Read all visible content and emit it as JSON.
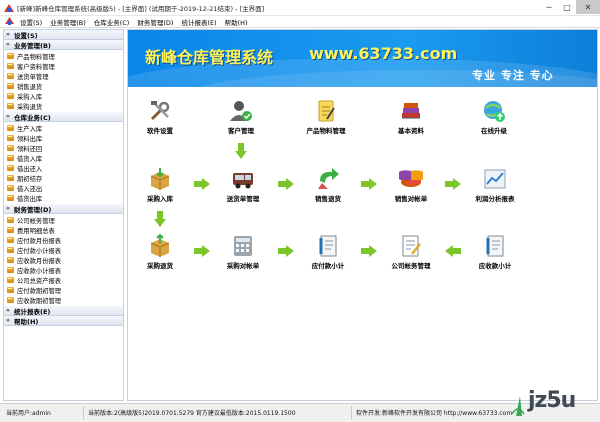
{
  "window": {
    "title": "[新峰]新峰仓库管理系统(高级版5) - [主界面] (试用期于-2019-12-21结束) - [主界面]",
    "min": "─",
    "max": "□",
    "close": "✕"
  },
  "menu": [
    "设置(S)",
    "业务管理(B)",
    "仓库业务(C)",
    "财务管理(D)",
    "统计报表(E)",
    "帮助(H)"
  ],
  "sidebar": {
    "sections": [
      {
        "title": "设置(S)",
        "items": []
      },
      {
        "title": "业务管理(B)",
        "items": [
          "产品物料管理",
          "客户资料管理",
          "送货单管理",
          "销售退货",
          "采购入库",
          "采购退货"
        ]
      },
      {
        "title": "仓库业务(C)",
        "items": [
          "生产入库",
          "领料出库",
          "领料还回",
          "借货入库",
          "借出还入",
          "期初结存",
          "借入还出",
          "借货出库"
        ]
      },
      {
        "title": "财务管理(D)",
        "items": [
          "公司帐务管理",
          "费用明细总表",
          "应付款月份报表",
          "应付款小计报表",
          "应收款月份报表",
          "应收款小计报表",
          "公司总资产报表",
          "应付款期初管理",
          "应收款期初管理"
        ]
      },
      {
        "title": "统计报表(E)",
        "items": []
      },
      {
        "title": "帮助(H)",
        "items": []
      }
    ]
  },
  "banner": {
    "title": "新峰仓库管理系统",
    "url": "www.63733.com",
    "slogan": "专业 专注 专心"
  },
  "flow": {
    "row1": [
      "软件设置",
      "客户管理",
      "产品物料管理",
      "基本资料",
      "在线升级"
    ],
    "row2": [
      "采购入库",
      "送货单管理",
      "销售退货",
      "销售对帐单",
      "利润分析报表"
    ],
    "row3": [
      "采购退货",
      "采购对帐单",
      "应付款小计",
      "公司帐务管理",
      "应收款小计"
    ]
  },
  "status": {
    "user": "当前用户:admin",
    "version": "当前版本:2(高级版5)2019.0701.5279 官方建议最低版本:2015.0119.1500",
    "developer": "软件开发:新峰软件开发有限公司 http://www.63733.com"
  },
  "watermark": "jz5u",
  "colors": {
    "banner": "#0a86e8",
    "banner_text": "#fff35a",
    "arrow": "#7cc62a"
  }
}
